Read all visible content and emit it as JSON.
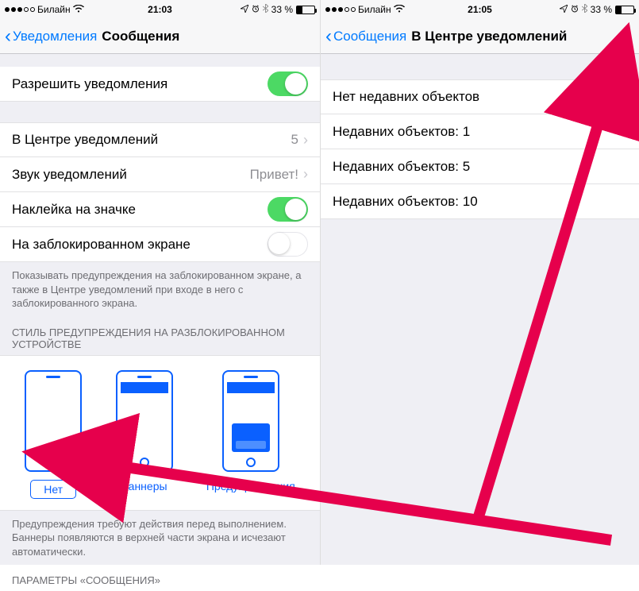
{
  "left": {
    "statusbar": {
      "carrier": "Билайн",
      "time": "21:03",
      "battery": "33 %"
    },
    "nav": {
      "back": "Уведомления",
      "title": "Сообщения"
    },
    "cells": {
      "allow": "Разрешить уведомления",
      "nc": "В Центре уведомлений",
      "nc_val": "5",
      "sound": "Звук уведомлений",
      "sound_val": "Привет!",
      "badge": "Наклейка на значке",
      "lockscreen": "На заблокированном экране"
    },
    "footer1": "Показывать предупреждения на заблокированном экране, а также в Центре уведомлений при входе в него с заблокированного экрана.",
    "header1": "СТИЛЬ ПРЕДУПРЕЖДЕНИЯ НА РАЗБЛОКИРОВАННОМ УСТРОЙСТВЕ",
    "styles": {
      "none": "Нет",
      "banners": "Баннеры",
      "alerts": "Предупреждения"
    },
    "footer2": "Предупреждения требуют действия перед выполнением. Баннеры появляются в верхней части экрана и исчезают автоматически.",
    "header2": "ПАРАМЕТРЫ «СООБЩЕНИЯ»"
  },
  "right": {
    "statusbar": {
      "carrier": "Билайн",
      "time": "21:05",
      "battery": "33 %"
    },
    "nav": {
      "back": "Сообщения",
      "title": "В Центре уведомлений"
    },
    "options": [
      "Нет недавних объектов",
      "Недавних объектов: 1",
      "Недавних объектов: 5",
      "Недавних объектов: 10"
    ]
  }
}
